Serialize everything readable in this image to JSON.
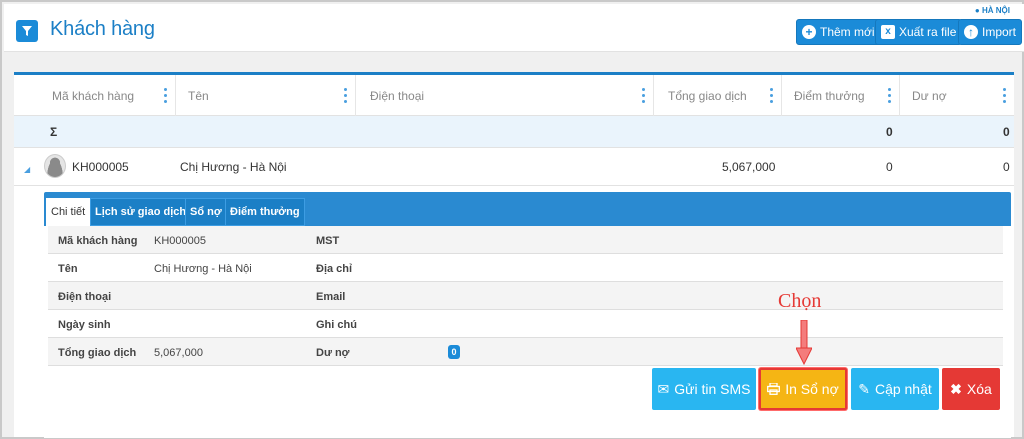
{
  "header": {
    "title": "Khách hàng",
    "region": "HÀ NỘI",
    "buttons": {
      "add": "Thêm mới",
      "export": "Xuất ra file",
      "import": "Import"
    }
  },
  "table": {
    "columns": [
      "Mã khách hàng",
      "Tên",
      "Điện thoại",
      "Tổng giao dịch",
      "Điểm thưởng",
      "Dư nợ"
    ],
    "sum_row": {
      "symbol": "Σ",
      "points": "0",
      "debt": "0"
    },
    "rows": [
      {
        "code": "KH000005",
        "name": "Chị Hương - Hà Nội",
        "total": "5,067,000",
        "points": "0",
        "debt": "0"
      }
    ]
  },
  "detail": {
    "tabs": [
      "Chi tiết",
      "Lịch sử giao dịch",
      "Sổ nợ",
      "Điểm thưởng"
    ],
    "fields": {
      "code_label": "Mã khách hàng",
      "code_value": "KH000005",
      "tax_label": "MST",
      "name_label": "Tên",
      "name_value": "Chị Hương - Hà Nội",
      "address_label": "Địa chỉ",
      "phone_label": "Điện thoại",
      "email_label": "Email",
      "birthday_label": "Ngày sinh",
      "note_label": "Ghi chú",
      "total_label": "Tổng giao dịch",
      "total_value": "5,067,000",
      "debt_label": "Dư nợ",
      "debt_value": "0"
    },
    "actions": {
      "sms": "Gửi tin SMS",
      "print": "In Sổ nợ",
      "update": "Cập nhật",
      "delete": "Xóa"
    }
  },
  "annotation": {
    "callout": "Chọn"
  },
  "colors": {
    "primary": "#1b8bd8",
    "print": "#f5b514",
    "delete": "#e53935",
    "sms": "#29b6f1"
  }
}
